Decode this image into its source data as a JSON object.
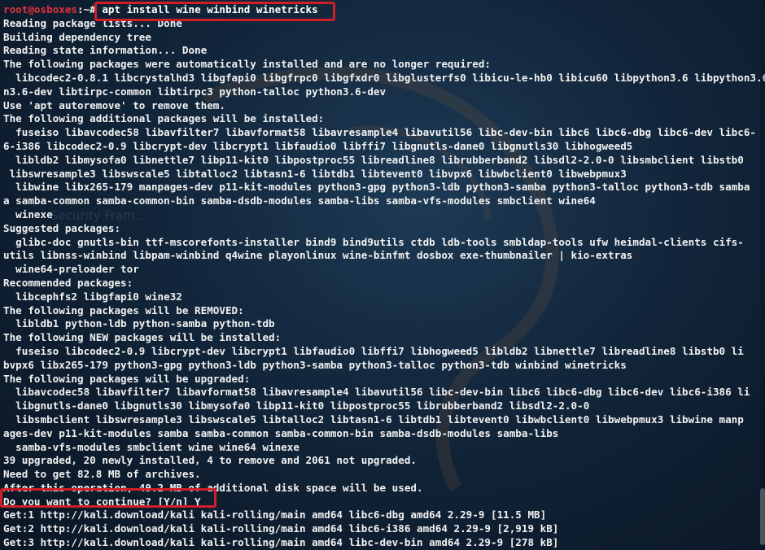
{
  "prompt": {
    "user": "root@osboxes",
    "path": ":~# ",
    "command": "apt install wine winbind winetricks"
  },
  "watermark": {
    "text1": "Security Fram…"
  },
  "output": [
    "Reading package lists... Done",
    "Building dependency tree",
    "Reading state information... Done",
    "The following packages were automatically installed and are no longer required:",
    "  libcodec2-0.8.1 libcrystalhd3 libgfapi0 libgfrpc0 libgfxdr0 libglusterfs0 libicu-le-hb0 libicu60 libpython3.6 libpython3.6-",
    "n3.6-dev libtirpc-common libtirpc3 python-talloc python3.6-dev",
    "Use 'apt autoremove' to remove them.",
    "The following additional packages will be installed:",
    "  fuseiso libavcodec58 libavfilter7 libavformat58 libavresample4 libavutil56 libc-dev-bin libc6 libc6-dbg libc6-dev libc6-",
    "6-i386 libcodec2-0.9 libcrypt-dev libcrypt1 libfaudio0 libffi7 libgnutls-dane0 libgnutls30 libhogweed5",
    "  libldb2 libmysofa0 libnettle7 libp11-kit0 libpostproc55 libreadline8 librubberband2 libsdl2-2.0-0 libsmbclient libstb0",
    " libswresample3 libswscale5 libtalloc2 libtasn1-6 libtdb1 libtevent0 libvpx6 libwbclient0 libwebpmux3",
    "  libwine libx265-179 manpages-dev p11-kit-modules python3-gpg python3-ldb python3-samba python3-talloc python3-tdb samba",
    "a samba-common samba-common-bin samba-dsdb-modules samba-libs samba-vfs-modules smbclient wine64",
    "  winexe",
    "Suggested packages:",
    "  glibc-doc gnutls-bin ttf-mscorefonts-installer bind9 bind9utils ctdb ldb-tools smbldap-tools ufw heimdal-clients cifs-",
    "utils libnss-winbind libpam-winbind q4wine playonlinux wine-binfmt dosbox exe-thumbnailer | kio-extras",
    "  wine64-preloader tor",
    "Recommended packages:",
    "  libcephfs2 libgfapi0 wine32",
    "The following packages will be REMOVED:",
    "  libldb1 python-ldb python-samba python-tdb",
    "The following NEW packages will be installed:",
    "  fuseiso libcodec2-0.9 libcrypt-dev libcrypt1 libfaudio0 libffi7 libhogweed5 libldb2 libnettle7 libreadline8 libstb0 li",
    "bvpx6 libx265-179 python3-gpg python3-ldb python3-samba python3-talloc python3-tdb winbind winetricks",
    "The following packages will be upgraded:",
    "  libavcodec58 libavfilter7 libavformat58 libavresample4 libavutil56 libc-dev-bin libc6 libc6-dbg libc6-dev libc6-i386 li",
    "  libgnutls-dane0 libgnutls30 libmysofa0 libp11-kit0 libpostproc55 librubberband2 libsdl2-2.0-0",
    "  libsmbclient libswresample3 libswscale5 libtalloc2 libtasn1-6 libtdb1 libtevent0 libwbclient0 libwebpmux3 libwine manp",
    "ages-dev p11-kit-modules samba samba-common samba-common-bin samba-dsdb-modules samba-libs",
    "  samba-vfs-modules smbclient wine wine64 winexe",
    "39 upgraded, 20 newly installed, 4 to remove and 2061 not upgraded.",
    "Need to get 82.8 MB of archives.",
    "After this operation, 49.2 MB of additional disk space will be used.",
    "Do you want to continue? [Y/n] Y",
    "Get:1 http://kali.download/kali kali-rolling/main amd64 libc6-dbg amd64 2.29-9 [11.5 MB]",
    "Get:2 http://kali.download/kali kali-rolling/main amd64 libc6-i386 amd64 2.29-9 [2,919 kB]",
    "Get:3 http://kali.download/kali kali-rolling/main amd64 libc-dev-bin amd64 2.29-9 [278 kB]"
  ]
}
